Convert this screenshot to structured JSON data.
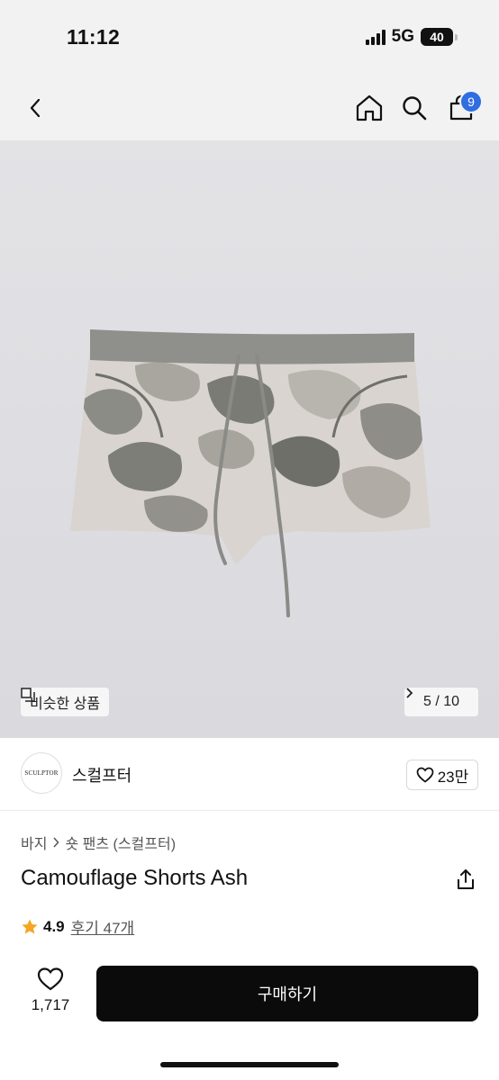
{
  "status_bar": {
    "time": "11:12",
    "network": "5G",
    "battery": "40"
  },
  "nav": {
    "cart_count": "9"
  },
  "gallery": {
    "similar_label": "비슷한 상품",
    "page_indicator": "5 / 10"
  },
  "brand": {
    "logo_text": "SCULPTOR",
    "name": "스컬프터",
    "like_count": "23만"
  },
  "breadcrumb": {
    "level1": "바지",
    "level2": "숏 팬츠 (스컬프터)"
  },
  "product": {
    "title": "Camouflage Shorts Ash",
    "rating": "4.9",
    "reviews_label": "후기 47개"
  },
  "bottom": {
    "wish_count": "1,717",
    "buy_label": "구매하기"
  },
  "colors": {
    "accent": "#2f6de1",
    "star": "#f5a623",
    "buy_button": "#0b0b0b"
  },
  "icons": [
    "chevron-left-icon",
    "home-icon",
    "search-icon",
    "cart-icon",
    "similar-icon",
    "chevron-right-icon",
    "heart-icon",
    "share-icon",
    "star-icon"
  ]
}
